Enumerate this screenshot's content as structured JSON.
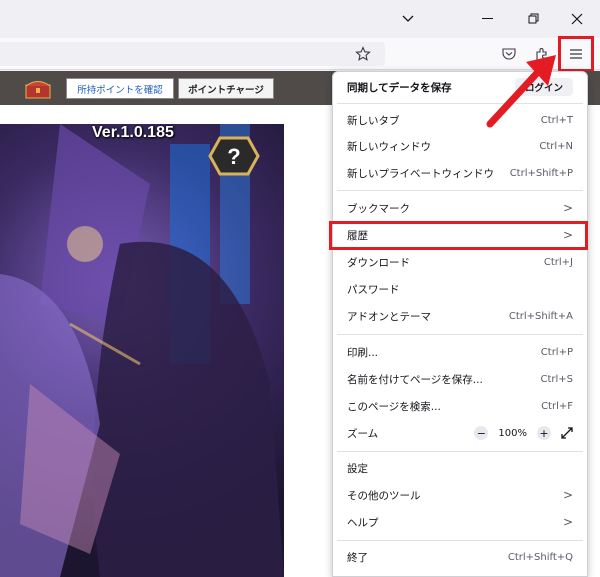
{
  "window": {
    "dropdown_icon": "chevron-down-icon",
    "minimize_icon": "minimize-icon",
    "restore_icon": "restore-icon",
    "close_icon": "close-icon"
  },
  "toolbar": {
    "bookmark_icon": "star-icon",
    "pocket_icon": "pocket-icon",
    "extensions_icon": "puzzle-icon",
    "menu_icon": "hamburger-menu-icon"
  },
  "site": {
    "points_button": "所持ポイントを確認",
    "charge_button": "ポイントチャージ",
    "version": "Ver.1.0.185",
    "help_badge": "?"
  },
  "menu": {
    "sync_title": "同期してデータを保存",
    "login_label": "ログイン",
    "items": [
      {
        "label": "新しいタブ",
        "shortcut": "Ctrl+T"
      },
      {
        "label": "新しいウィンドウ",
        "shortcut": "Ctrl+N"
      },
      {
        "label": "新しいプライベートウィンドウ",
        "shortcut": "Ctrl+Shift+P"
      },
      {
        "label": "ブックマーク",
        "shortcut": ">"
      },
      {
        "label": "履歴",
        "shortcut": ">"
      },
      {
        "label": "ダウンロード",
        "shortcut": "Ctrl+J"
      },
      {
        "label": "パスワード",
        "shortcut": ""
      },
      {
        "label": "アドオンとテーマ",
        "shortcut": "Ctrl+Shift+A"
      },
      {
        "label": "印刷...",
        "shortcut": "Ctrl+P"
      },
      {
        "label": "名前を付けてページを保存...",
        "shortcut": "Ctrl+S"
      },
      {
        "label": "このページを検索...",
        "shortcut": "Ctrl+F"
      },
      {
        "label": "ズーム",
        "shortcut": ""
      },
      {
        "label": "設定",
        "shortcut": ""
      },
      {
        "label": "その他のツール",
        "shortcut": ">"
      },
      {
        "label": "ヘルプ",
        "shortcut": ">"
      },
      {
        "label": "終了",
        "shortcut": "Ctrl+Shift+Q"
      }
    ],
    "zoom": {
      "minus": "−",
      "value": "100%",
      "plus": "+",
      "fullscreen_icon": "expand-icon"
    }
  },
  "colors": {
    "highlight": "#e31b23"
  }
}
